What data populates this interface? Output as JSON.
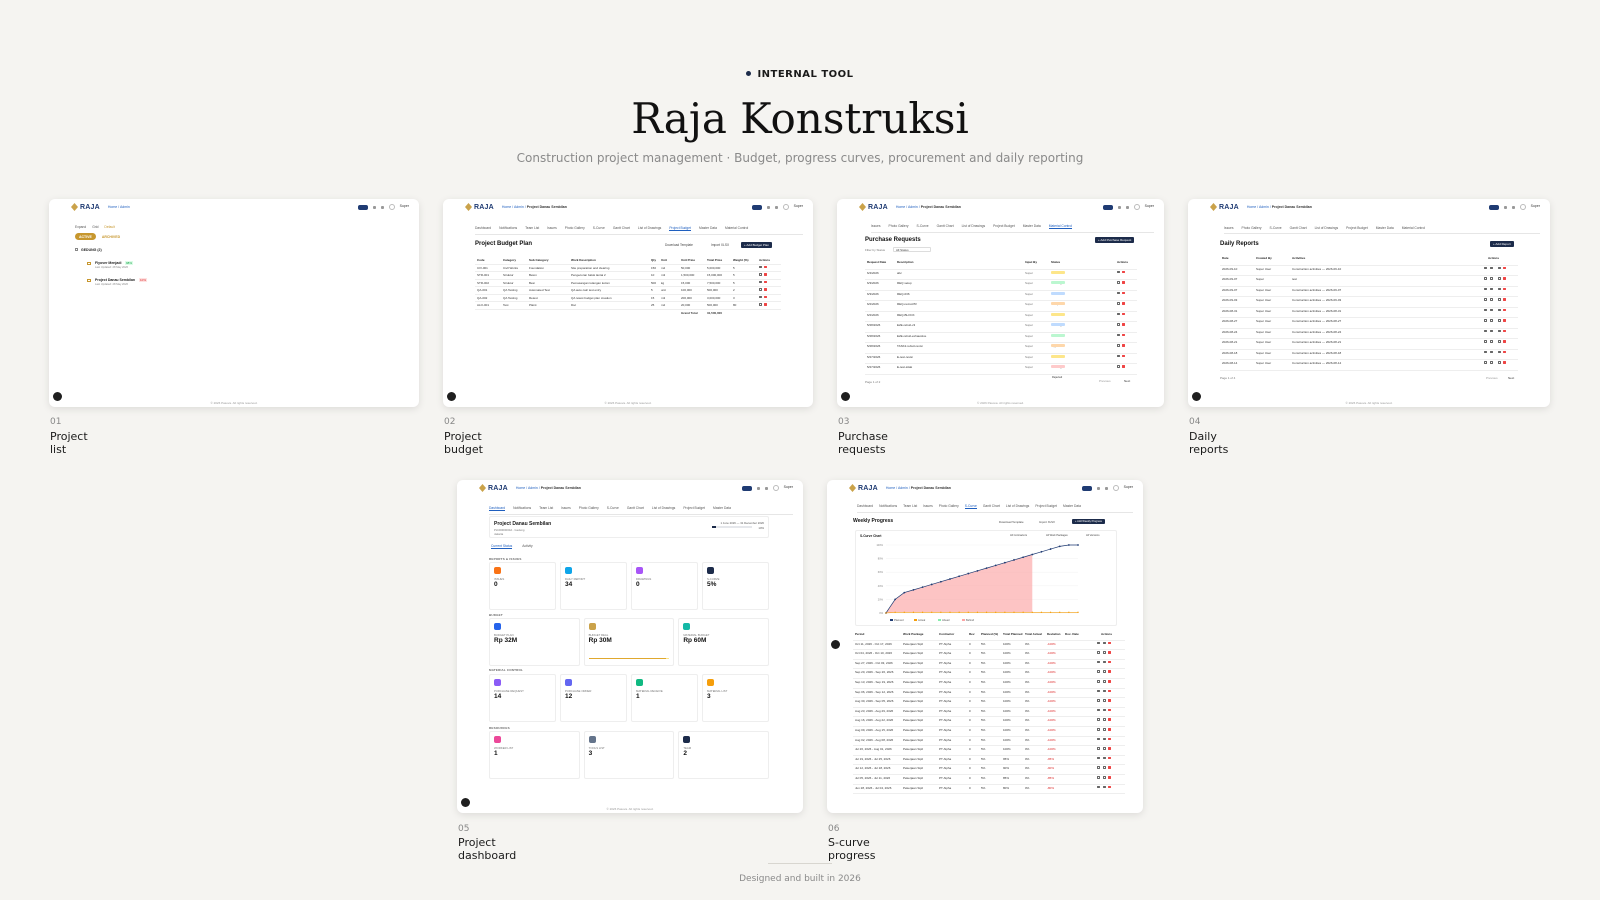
{
  "header": {
    "eyebrow": "INTERNAL TOOL",
    "title": "Raja Konstruksi",
    "subtitle": "Construction project management  ·  Budget, progress curves, procurement and daily reporting"
  },
  "footer": {
    "text": "Designed and built in 2026"
  },
  "app": {
    "logo": "RAJA",
    "crumb_home": "Home",
    "crumb_admin": "Admin",
    "crumb_project": "Project Danau Sembilan",
    "user": "Super",
    "copyright": "© 2026 Pasova. All rights reserved."
  },
  "cards": [
    {
      "num": "01",
      "caption": "Project list"
    },
    {
      "num": "02",
      "caption": "Project budget"
    },
    {
      "num": "03",
      "caption": "Purchase requests"
    },
    {
      "num": "04",
      "caption": "Daily reports"
    },
    {
      "num": "05",
      "caption": "Project dashboard"
    },
    {
      "num": "06",
      "caption": "S-curve progress"
    }
  ],
  "tabs": [
    "Dashboard",
    "Notifications",
    "Team List",
    "Issues",
    "Photo Gallery",
    "S-Curve",
    "Gantt Chart",
    "List of Drawings",
    "Project Budget",
    "Master Data",
    "Material Control"
  ],
  "shot1": {
    "toolbar": [
      "Expand",
      "Grid",
      "Default"
    ],
    "status_active": "ACTIVE",
    "status_archived": "ARCHIVED",
    "group": "GEDUNG (2)",
    "projects": [
      {
        "name": "Flyover Menjadi",
        "badge": "98%",
        "date": "Last Updated: 28 May 2026"
      },
      {
        "name": "Project Danau Sembilan",
        "badge": "10%",
        "date": "Last Updated: 28 May 2026"
      }
    ]
  },
  "shot2": {
    "title": "Project Budget Plan",
    "download": "Download Template",
    "import": "Import XLSX",
    "add": "+ Add Budget Plan",
    "columns": [
      "Code",
      "Category",
      "Sub Category",
      "Work Description",
      "Qty",
      "Unit",
      "Unit Price",
      "Total Price",
      "Weight (%)",
      "Actions"
    ],
    "rows": [
      [
        "CIV-001",
        "Civil Works",
        "Foundation",
        "Site preparation and clearing",
        "150",
        "m2",
        "50,000",
        "5,000,000",
        "5"
      ],
      [
        "STR-001",
        "Struktur",
        "Beton",
        "Pengecoran balok lantai 2",
        "10",
        "m3",
        "1,500,000",
        "15,000,000",
        "5"
      ],
      [
        "STR-002",
        "Struktur",
        "Besi",
        "Pemasangan tulangan kolom",
        "500",
        "kg",
        "15,000",
        "7,500,000",
        "5"
      ],
      [
        "QA-001",
        "QA Testing",
        "Automated Test",
        "QA auto calc test entry",
        "5",
        "unit",
        "100,000",
        "500,000",
        "2"
      ],
      [
        "QA-002",
        "QA Testing",
        "Retest",
        "QA retest budget plan creation",
        "15",
        "m3",
        "200,000",
        "3,000,000",
        "3"
      ],
      [
        "ALO-001",
        "Test",
        "Plaint",
        "Dsc",
        "25",
        "m2",
        "20,000",
        "500,000",
        "80"
      ]
    ],
    "grand_label": "Grand Total",
    "grand_value": "31,500,000"
  },
  "shot3": {
    "title": "Purchase Requests",
    "add": "+ Add Purchase Request",
    "filter": "Filter by Status",
    "filter_value": "All Status",
    "columns": [
      "Request Date",
      "Description",
      "Input By",
      "Status",
      "Actions"
    ],
    "rows": [
      [
        "6/4/2026",
        "abc",
        "Pending"
      ],
      [
        "6/3/2026",
        "REQ setup",
        "Approved"
      ],
      [
        "6/3/2026",
        "REQ-036",
        "Completed"
      ],
      [
        "6/2/2026",
        "REQ-revisi-PR",
        "Revision"
      ],
      [
        "6/2/2026",
        "REQ-BLOCK",
        "Pending"
      ],
      [
        "5/28/2026",
        "E2E-rebuil-v3",
        "Completed"
      ],
      [
        "5/28/2026",
        "E2E-rebuil-exhaustive",
        "Approved"
      ],
      [
        "5/28/2026",
        "TASK2-rebuil-revisi",
        "Revision"
      ],
      [
        "5/27/2026",
        "E-test-revisi",
        "Pending"
      ],
      [
        "5/27/2026",
        "E-test-tolak",
        "Rejected"
      ]
    ],
    "page": "Page 1 of 2",
    "prev": "Previous",
    "next": "Next"
  },
  "shot4": {
    "title": "Daily Reports",
    "add": "+ Add Report",
    "columns": [
      "Date",
      "Created By",
      "Activities",
      "Actions"
    ],
    "rows": [
      [
        "2026-09-10",
        "Super User",
        "Construction activities — 2026-09-10"
      ],
      [
        "2026-09-07",
        "Super",
        "test"
      ],
      [
        "2026-09-07",
        "Super User",
        "Construction activities — 2026-09-07"
      ],
      [
        "2026-09-03",
        "Super User",
        "Construction activities — 2026-09-03"
      ],
      [
        "2026-08-31",
        "Super User",
        "Construction activities — 2026-08-31"
      ],
      [
        "2026-08-27",
        "Super User",
        "Construction activities — 2026-08-27"
      ],
      [
        "2026-08-24",
        "Super User",
        "Construction activities — 2026-08-24"
      ],
      [
        "2026-08-21",
        "Super User",
        "Construction activities — 2026-08-21"
      ],
      [
        "2026-08-18",
        "Super User",
        "Construction activities — 2026-08-18"
      ],
      [
        "2026-08-14",
        "Super User",
        "Construction activities — 2026-08-14"
      ]
    ],
    "page": "Page 1 of 4",
    "prev": "Previous",
    "next": "Next"
  },
  "shot5": {
    "project": "Project Danau Sembilan",
    "sub": "PLN0000000A · Gedung",
    "city": "Jakarta",
    "dates": "1 June 2026 — 31 December 2026",
    "pct": "10%",
    "tab1": "Current Status",
    "tab2": "Activity",
    "sec_reports": "REPORTS & ISSUES",
    "sec_budget": "BUDGET",
    "sec_material": "MATERIAL CONTROL",
    "sec_resources": "RESOURCES",
    "kpi_reports": [
      {
        "label": "ISSUES",
        "value": "0"
      },
      {
        "label": "DAILY REPORT",
        "value": "34"
      },
      {
        "label": "DRAWINGS",
        "value": "0"
      },
      {
        "label": "S-CURVE",
        "value": "5%"
      }
    ],
    "kpi_budget": [
      {
        "label": "BUDGET PLAN",
        "value": "Rp 32M"
      },
      {
        "label": "BUDGET REAL",
        "value": "Rp 30M"
      },
      {
        "label": "MATERIAL BUDGET",
        "value": "Rp 60M"
      }
    ],
    "kpi_material": [
      {
        "label": "PURCHASE REQUEST",
        "value": "14"
      },
      {
        "label": "PURCHASE ORDER",
        "value": "12"
      },
      {
        "label": "MATERIAL RECEIVE",
        "value": "1"
      },
      {
        "label": "MATERIAL LIST",
        "value": "3"
      }
    ],
    "kpi_resources": [
      {
        "label": "WORKER LIST",
        "value": "1"
      },
      {
        "label": "TOOLS LIST",
        "value": "3"
      },
      {
        "label": "TEAM",
        "value": "2"
      }
    ]
  },
  "shot6": {
    "title": "Weekly Progress",
    "chart_title": "S-Curve Chart",
    "download": "Download Template",
    "import": "Import XLSX",
    "add": "+ Add Weekly Progress",
    "filter1": "All Contractors",
    "filter2": "All Work Packages",
    "filter3": "All Versions",
    "legend": [
      "Planned",
      "Actual",
      "Ahead",
      "Behind"
    ],
    "yticks": [
      "100%",
      "80%",
      "60%",
      "40%",
      "20%",
      "0%"
    ],
    "columns": [
      "Period",
      "Work Package",
      "Contractor",
      "Rev",
      "Planned (%)",
      "Total Planned",
      "Total Actual",
      "Deviation",
      "Doc. Date",
      "Actions"
    ],
    "rows": [
      [
        "Oct 11, 2026 - Oct 17, 2026",
        "Pekerjaan Sipil",
        "PT Alpha",
        "0",
        "5%",
        "100%",
        "0%",
        "-100%"
      ],
      [
        "Oct 04, 2026 - Oct 10, 2026",
        "Pekerjaan Sipil",
        "PT Alpha",
        "0",
        "5%",
        "100%",
        "0%",
        "-100%"
      ],
      [
        "Sep 27, 2026 - Oct 03, 2026",
        "Pekerjaan Sipil",
        "PT Alpha",
        "0",
        "5%",
        "100%",
        "0%",
        "-100%"
      ],
      [
        "Sep 20, 2026 - Sep 26, 2026",
        "Pekerjaan Sipil",
        "PT Alpha",
        "0",
        "5%",
        "100%",
        "0%",
        "-100%"
      ],
      [
        "Sep 13, 2026 - Sep 19, 2026",
        "Pekerjaan Sipil",
        "PT Alpha",
        "0",
        "5%",
        "100%",
        "0%",
        "-100%"
      ],
      [
        "Sep 06, 2026 - Sep 12, 2026",
        "Pekerjaan Sipil",
        "PT Alpha",
        "0",
        "5%",
        "100%",
        "0%",
        "-100%"
      ],
      [
        "Aug 30, 2026 - Sep 05, 2026",
        "Pekerjaan Sipil",
        "PT Alpha",
        "0",
        "5%",
        "100%",
        "0%",
        "-100%"
      ],
      [
        "Aug 23, 2026 - Aug 29, 2026",
        "Pekerjaan Sipil",
        "PT Alpha",
        "0",
        "5%",
        "100%",
        "0%",
        "-100%"
      ],
      [
        "Aug 16, 2026 - Aug 22, 2026",
        "Pekerjaan Sipil",
        "PT Alpha",
        "0",
        "5%",
        "100%",
        "0%",
        "-100%"
      ],
      [
        "Aug 09, 2026 - Aug 15, 2026",
        "Pekerjaan Sipil",
        "PT Alpha",
        "0",
        "5%",
        "100%",
        "0%",
        "-100%"
      ],
      [
        "Aug 02, 2026 - Aug 08, 2026",
        "Pekerjaan Sipil",
        "PT Alpha",
        "0",
        "5%",
        "100%",
        "0%",
        "-100%"
      ],
      [
        "Jul 26, 2026 - Aug 01, 2026",
        "Pekerjaan Sipil",
        "PT Alpha",
        "0",
        "5%",
        "100%",
        "0%",
        "-100%"
      ],
      [
        "Jul 19, 2026 - Jul 25, 2026",
        "Pekerjaan Sipil",
        "PT Alpha",
        "0",
        "5%",
        "95%",
        "0%",
        "-95%"
      ],
      [
        "Jul 12, 2026 - Jul 18, 2026",
        "Pekerjaan Sipil",
        "PT Alpha",
        "0",
        "5%",
        "90%",
        "0%",
        "-90%"
      ],
      [
        "Jul 05, 2026 - Jul 11, 2026",
        "Pekerjaan Sipil",
        "PT Alpha",
        "0",
        "5%",
        "85%",
        "0%",
        "-85%"
      ],
      [
        "Jun 28, 2026 - Jul 04, 2026",
        "Pekerjaan Sipil",
        "PT Alpha",
        "0",
        "5%",
        "80%",
        "0%",
        "-80%"
      ]
    ],
    "chart_data": {
      "type": "area",
      "title": "S-Curve Chart",
      "x": [
        1,
        2,
        3,
        4,
        5,
        6,
        7,
        8,
        9,
        10,
        11,
        12,
        13,
        14,
        15,
        16,
        17,
        18,
        19,
        20,
        21,
        22
      ],
      "series": [
        {
          "name": "Planned",
          "values": [
            0,
            20,
            30,
            34,
            38,
            42,
            46,
            50,
            54,
            58,
            62,
            66,
            70,
            74,
            78,
            82,
            86,
            90,
            94,
            98,
            100,
            100
          ]
        },
        {
          "name": "Actual",
          "values": [
            0,
            1,
            1,
            1,
            1,
            1,
            1,
            1,
            1,
            1,
            1,
            1,
            1,
            1,
            1,
            1,
            1,
            1,
            1,
            1,
            1,
            1
          ]
        }
      ],
      "ylim": [
        0,
        100
      ]
    }
  }
}
